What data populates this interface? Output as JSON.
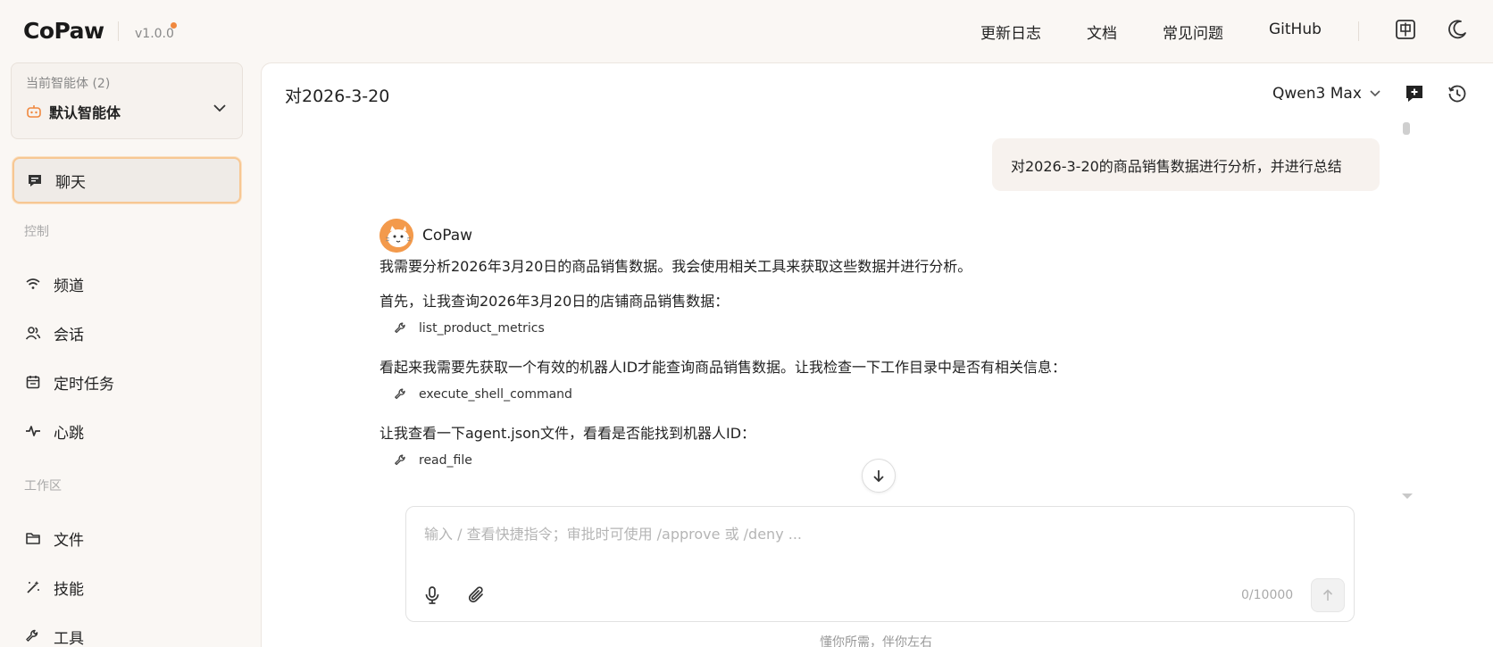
{
  "header": {
    "logo": "CoPaw",
    "version": "v1.0.0",
    "nav": [
      "更新日志",
      "文档",
      "常见问题",
      "GitHub"
    ],
    "icons": [
      "language-icon",
      "theme-toggle-icon"
    ]
  },
  "sidebar": {
    "agent_count_label": "当前智能体 (2)",
    "agent_name": "默认智能体",
    "chat_label": "聊天",
    "section_control": "控制",
    "control_items": [
      "频道",
      "会话",
      "定时任务",
      "心跳"
    ],
    "section_workspace": "工作区",
    "workspace_items": [
      "文件",
      "技能",
      "工具"
    ]
  },
  "main": {
    "title": "对2026-3-20",
    "model": "Qwen3 Max",
    "user_message": "对2026-3-20的商品销售数据进行分析，并进行总结",
    "bot_name": "CoPaw",
    "lines": [
      "我需要分析2026年3月20日的商品销售数据。我会使用相关工具来获取这些数据并进行分析。",
      "首先，让我查询2026年3月20日的店铺商品销售数据：",
      "看起来我需要先获取一个有效的机器人ID才能查询商品销售数据。让我检查一下工作目录中是否有相关信息：",
      "让我查看一下agent.json文件，看看是否能找到机器人ID："
    ],
    "tools": [
      "list_product_metrics",
      "execute_shell_command",
      "read_file"
    ],
    "input_placeholder": "输入 / 查看快捷指令；审批时可使用 /approve 或 /deny ...",
    "input_value": "",
    "counter": "0/10000",
    "footer_note": "懂你所需，伴你左右"
  },
  "colors": {
    "accent": "#f0883e",
    "active_border": "#f7c793",
    "background": "#faf7f4"
  }
}
